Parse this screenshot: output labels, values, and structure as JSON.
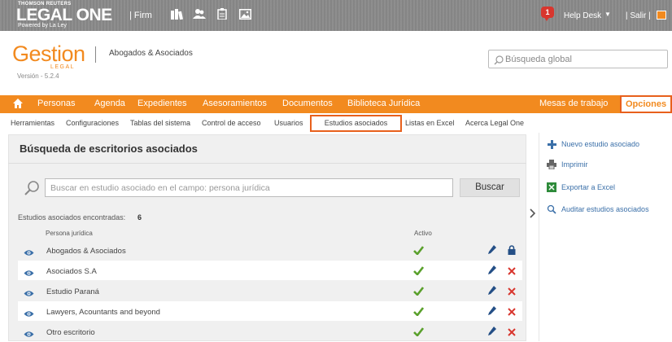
{
  "topbar": {
    "brand_small": "THOMSON REUTERS",
    "brand_main": "LEGAL ONE",
    "brand_powered": "Powered by La Ley",
    "firm_label": "| Firm",
    "icons": [
      "books-icon",
      "users-icon",
      "clipboard-icon",
      "image-icon"
    ],
    "notification_count": "1",
    "help_desk": "Help Desk",
    "salir": "| Salir |"
  },
  "header": {
    "logo": "Gestion",
    "logo_sub": "LEGAL",
    "firm_name": "Abogados & Asociados",
    "version": "Versión - 5.2.4",
    "search_placeholder": "Búsqueda global"
  },
  "nav": {
    "items": [
      "Personas",
      "Agenda",
      "Expedientes",
      "Asesoramientos",
      "Documentos",
      "Biblioteca Jurídica",
      "Mesas de trabajo",
      "Opciones"
    ]
  },
  "subnav": {
    "items": [
      "Herramientas",
      "Configuraciones",
      "Tablas del sistema",
      "Control de acceso",
      "Usuarios",
      "Estudios asociados",
      "Listas en Excel",
      "Acerca Legal One"
    ]
  },
  "main": {
    "title": "Búsqueda de escritorios asociados",
    "search_placeholder": "Buscar en estudio asociado en el campo: persona jurídica",
    "search_button": "Buscar",
    "found_label": "Estudios asociados encontradas:",
    "found_count": "6",
    "columns": [
      "Persona jurídica",
      "Activo"
    ],
    "rows": [
      {
        "name": "Abogados & Asociados",
        "action": "lock-icon"
      },
      {
        "name": "Asociados S.A",
        "action": "delete-icon"
      },
      {
        "name": "Estudio Paraná",
        "action": "delete-icon"
      },
      {
        "name": "Lawyers, Acountants and beyond",
        "action": "delete-icon"
      },
      {
        "name": "Otro escritorio",
        "action": "delete-icon"
      }
    ]
  },
  "sidebar": {
    "items": [
      "Nuevo estudio asociado",
      "Imprimir",
      "Exportar a Excel",
      "Auditar estudios asociados"
    ]
  },
  "colors": {
    "accent": "#f28a1f",
    "highlight_border": "#e8601c",
    "check": "#5aa02c",
    "delete": "#d8362e",
    "link": "#3a6fa8"
  }
}
